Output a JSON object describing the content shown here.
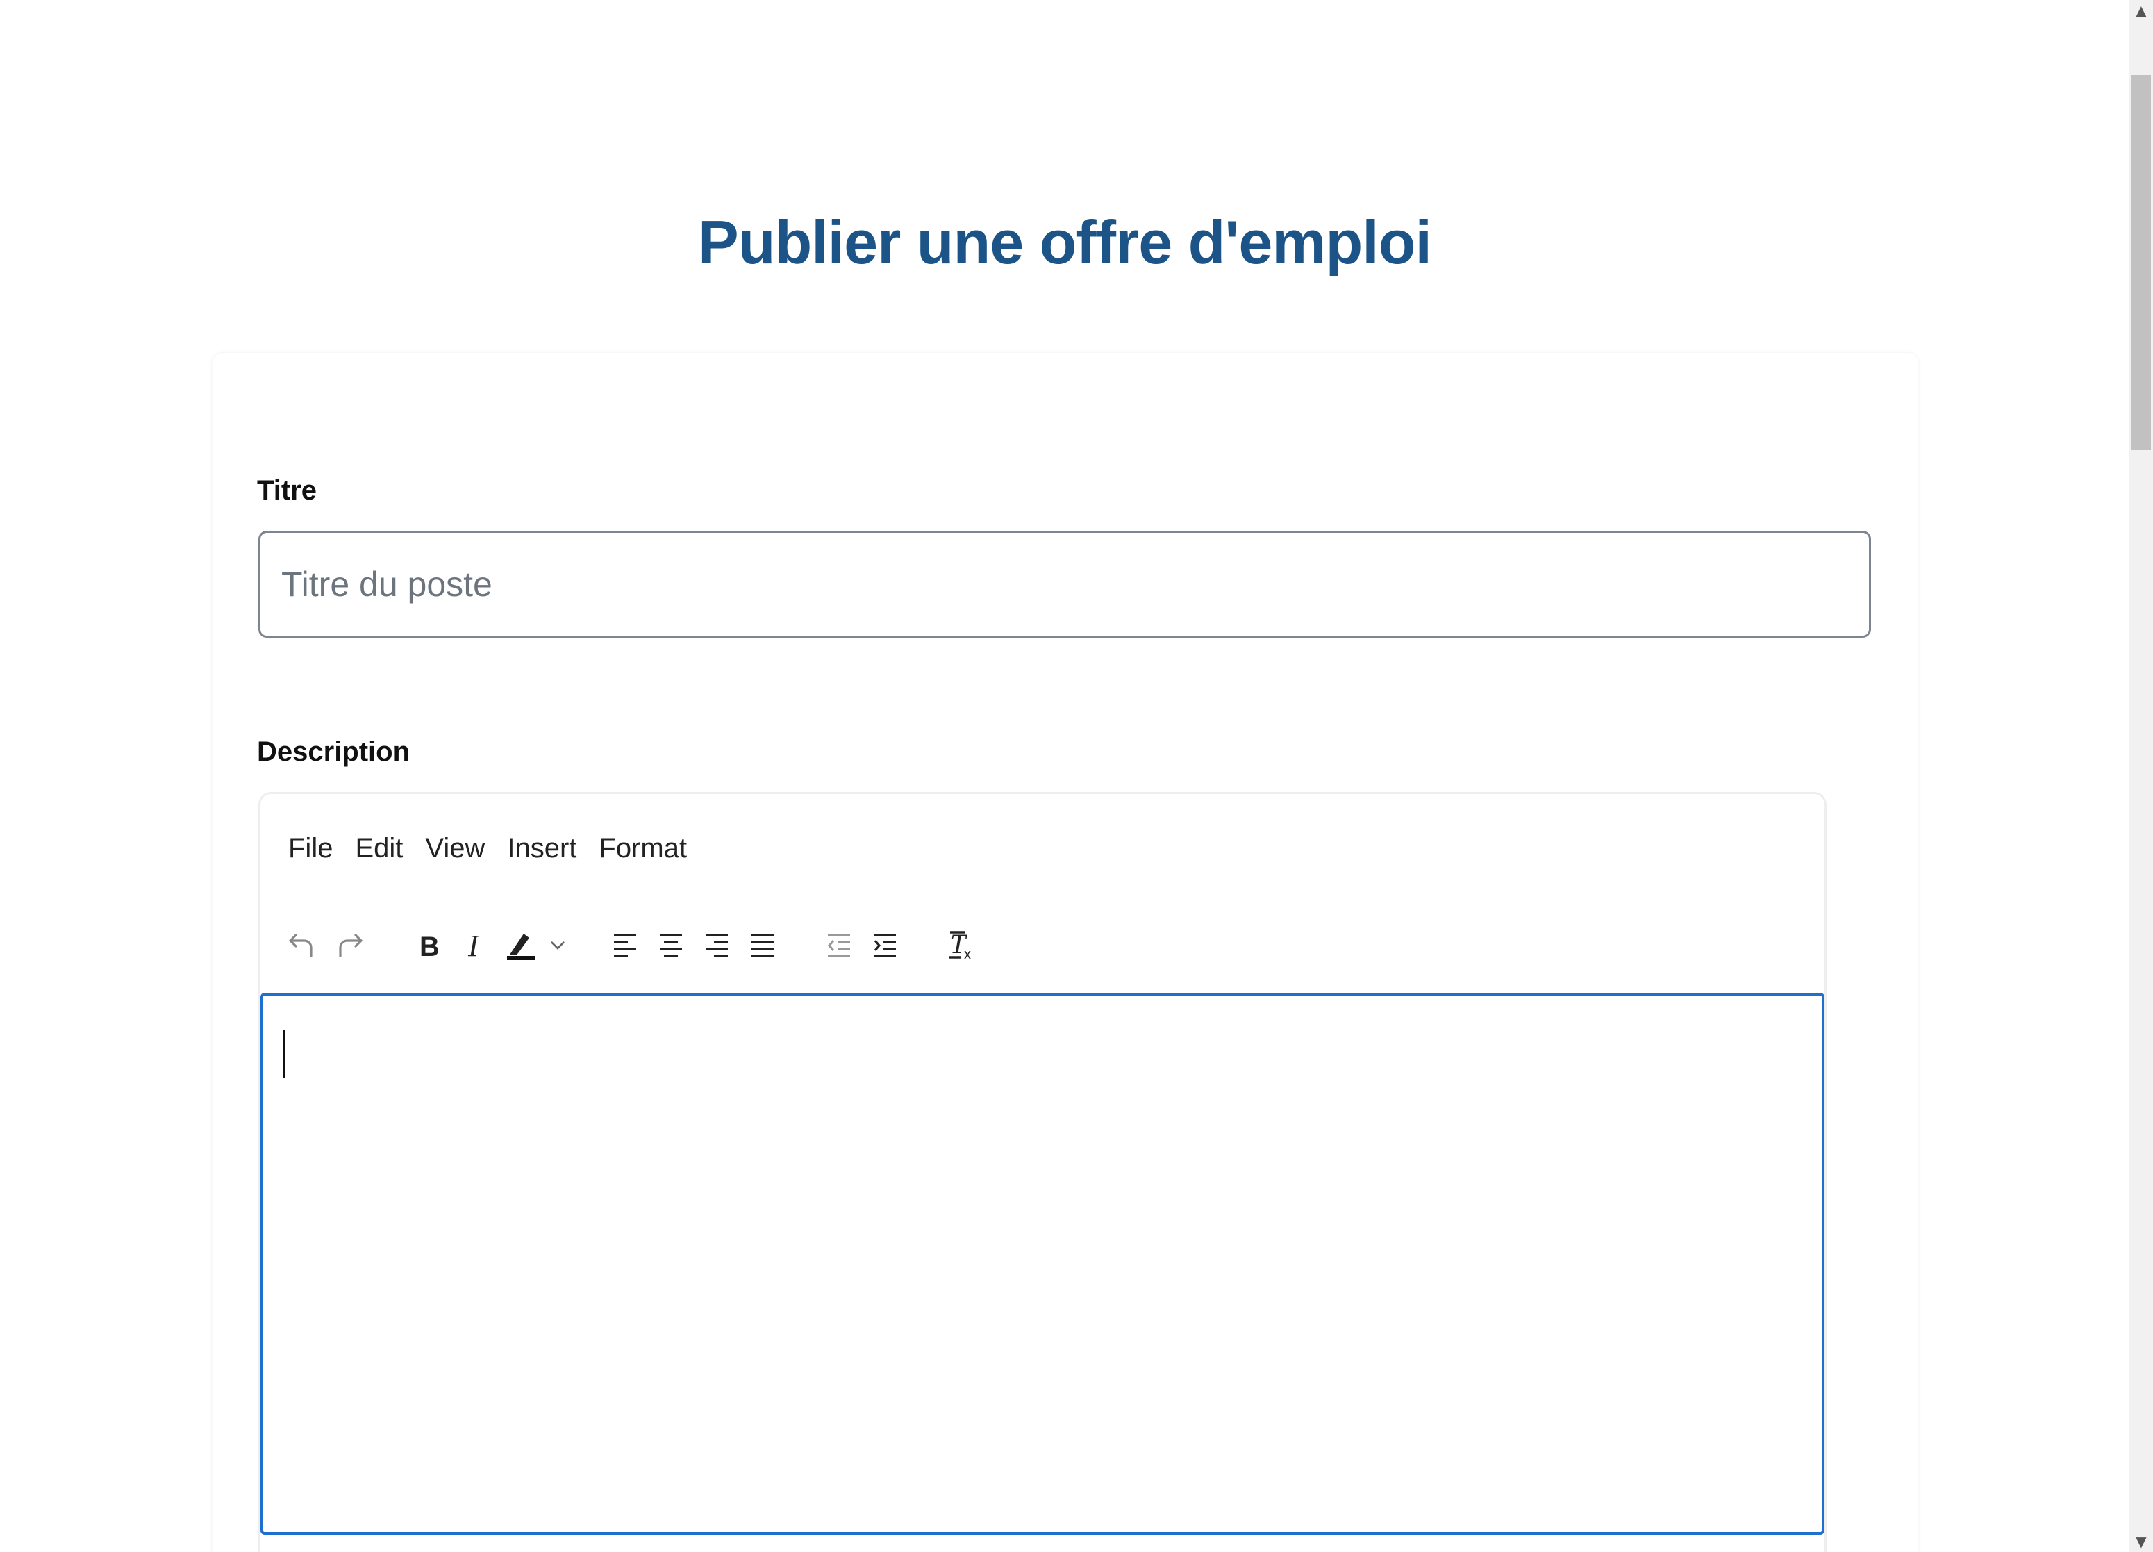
{
  "page": {
    "title": "Publier une offre d'emploi"
  },
  "form": {
    "title_label": "Titre",
    "title_placeholder": "Titre du poste",
    "title_value": "",
    "description_label": "Description"
  },
  "editor": {
    "menu": [
      "File",
      "Edit",
      "View",
      "Insert",
      "Format"
    ],
    "toolbar": [
      "undo-icon",
      "redo-icon",
      "bold-icon",
      "italic-icon",
      "highlight-icon",
      "chevron-down-icon",
      "align-left-icon",
      "align-center-icon",
      "align-right-icon",
      "align-justify-icon",
      "outdent-icon",
      "indent-icon",
      "clear-formatting-icon"
    ],
    "content": "",
    "focus_color": "#1f6fd1"
  },
  "colors": {
    "title": "#1c5488",
    "input_border": "#7d8590"
  },
  "scrollbar": {
    "up_arrow": "▲",
    "down_arrow": "▼"
  }
}
